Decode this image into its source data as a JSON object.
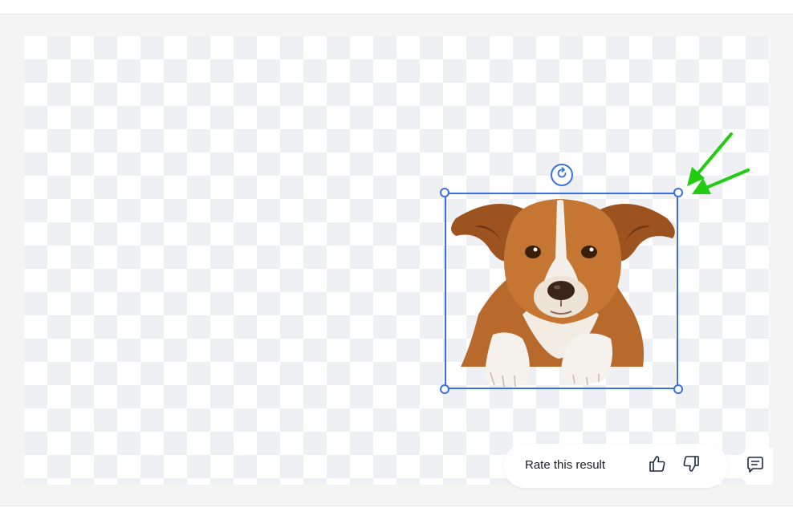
{
  "editor": {
    "canvas": {
      "background": "transparent-checkerboard",
      "subject": "dog (background removed)"
    },
    "selection": {
      "accent_color": "#3b6fe0",
      "handles": [
        "top-left",
        "top-right",
        "bottom-left",
        "bottom-right"
      ],
      "rotate_icon": "rotate-icon"
    },
    "annotation": {
      "arrow_color": "#22cc11",
      "target": "top-right-resize-handle"
    }
  },
  "feedback": {
    "rate_label": "Rate this result",
    "thumbs_up_icon": "thumbs-up-icon",
    "thumbs_down_icon": "thumbs-down-icon",
    "comment_icon": "comment-icon"
  }
}
